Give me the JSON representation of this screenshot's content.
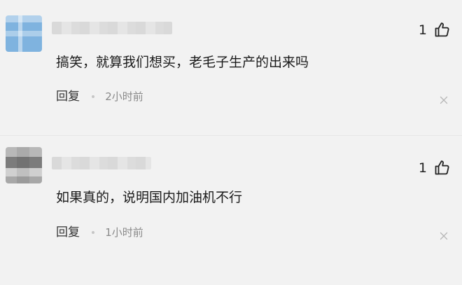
{
  "comments": [
    {
      "likes": "1",
      "text": "搞笑，就算我们想买，老毛子生产的出来吗",
      "reply_label": "回复",
      "time": "2小时前"
    },
    {
      "likes": "1",
      "text": "如果真的，说明国内加油机不行",
      "reply_label": "回复",
      "time": "1小时前"
    }
  ],
  "icons": {
    "like": "thumbs-up-icon",
    "close": "close-icon"
  },
  "colors": {
    "background": "#f2f2f2",
    "text": "#1a1a1a",
    "muted": "#8a8a8a"
  }
}
